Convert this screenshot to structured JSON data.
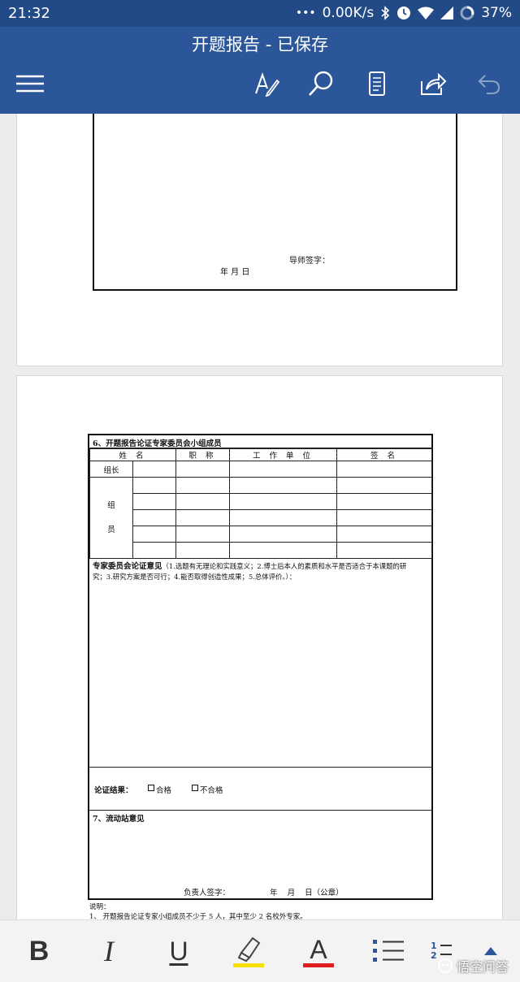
{
  "status_bar": {
    "time": "21:32",
    "dots": "•••",
    "network_speed": "0.00K/s",
    "battery": "37%",
    "icons": [
      "bluetooth-icon",
      "alarm-icon",
      "wifi-icon",
      "signal-icon",
      "battery-icon"
    ]
  },
  "app_bar": {
    "title": "开题报告 - 已保存",
    "icons": [
      "menu-icon",
      "edit-icon",
      "search-icon",
      "mobile-view-icon",
      "share-icon",
      "undo-icon"
    ]
  },
  "page1": {
    "advisor_signature": "导师签字：",
    "date_line": "年  月  日"
  },
  "page2": {
    "section6_title": "6、开题报告论证专家委员会小组成员",
    "headers": [
      "姓 名",
      "职 称",
      "工 作 单 位",
      "签 名"
    ],
    "row_leader": "组长",
    "row_member_1": "组",
    "row_member_2": "员",
    "opinion_title": "专家委员会论证意见",
    "opinion_text_1": "（1.选题有无理论和实践意义；2.博士后本人的素质和水平是否适合于本课题的研",
    "opinion_text_2": "究；3.研究方案是否可行；4.能否取得创造性成果；5.总体评价。）：",
    "result_label": "论证结果：",
    "pass_option": "合格",
    "fail_option": "不合格",
    "section7_title": "7、流动站意见",
    "responsible_signature": "负责人签字：",
    "seal_date": "年    月    日（公章）",
    "note_label": "说明：",
    "note_1": "1、  开题报告论证专家小组成员不少于 5 人，其中至少 2 名校外专家。"
  },
  "toolbar": {
    "bold": "B",
    "italic": "I",
    "underline": "U",
    "font_color": "A",
    "numbered_list_1": "1",
    "numbered_list_2": "2",
    "colors": {
      "highlight": "#f5e000",
      "font_color": "#e02020"
    }
  },
  "watermark": "悟空问答",
  "colors": {
    "status_bar": "#214a86",
    "app_bar": "#2b579a"
  }
}
